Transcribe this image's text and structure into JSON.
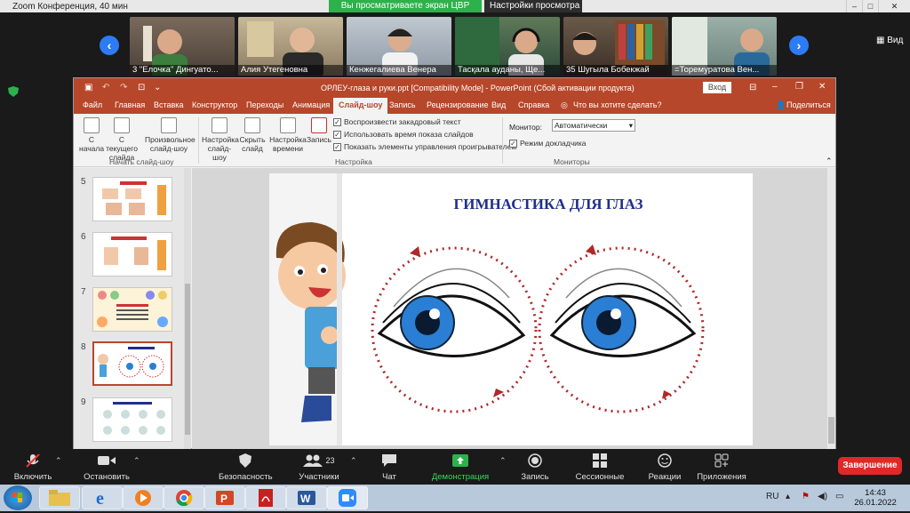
{
  "zoom": {
    "window_title": "Zoom Конференция, 40 мин",
    "share_status": "Вы просматриваете экран ЦВР",
    "view_options": "Настройки просмотра",
    "view_label": "Вид",
    "participants": [
      {
        "name": "3 \"Елочка\" Дингуато..."
      },
      {
        "name": "Алия Утегеновна"
      },
      {
        "name": "Кенжегалиева Венера"
      },
      {
        "name": "Тасқала ауданы, Ще..."
      },
      {
        "name": "35 Шугыла Бобекжай"
      },
      {
        "name": "=Торемуратова Вен..."
      }
    ],
    "toolbar": {
      "unmute": "Включить звук",
      "stop_video": "Остановить видео",
      "security": "Безопасность",
      "participants": "Участники",
      "participants_count": "23",
      "chat": "Чат",
      "share_screen": "Демонстрация экрана",
      "record": "Запись",
      "breakout": "Сессионные залы",
      "reactions": "Реакции",
      "apps": "Приложения",
      "end": "Завершение"
    }
  },
  "ppt": {
    "title": "ОРЛЕУ-глаза и руки.ppt [Compatibility Mode] - PowerPoint (Сбой активации продукта)",
    "signin": "Вход",
    "tabs": [
      "Файл",
      "Главная",
      "Вставка",
      "Конструктор",
      "Переходы",
      "Анимация",
      "Слайд-шоу",
      "Запись",
      "Рецензирование",
      "Вид",
      "Справка"
    ],
    "tell_me": "Что вы хотите сделать?",
    "share": "Поделиться",
    "ribbon": {
      "btn_from_start": "С начала",
      "btn_from_current": "С текущего слайда",
      "btn_custom": "Произвольное слайд-шоу",
      "group_start": "Начать слайд-шоу",
      "btn_setup": "Настройка слайд-шоу",
      "btn_hide": "Скрыть слайд",
      "btn_timings": "Настройка времени",
      "btn_record": "Запись",
      "chk_narration": "Воспроизвести закадровый текст",
      "chk_timings": "Использовать время показа слайдов",
      "chk_media": "Показать элементы управления проигрывателем",
      "group_setup": "Настройка",
      "monitor_label": "Монитор:",
      "monitor_value": "Автоматически",
      "chk_presenter": "Режим докладчика",
      "group_monitors": "Мониторы"
    },
    "slides": [
      {
        "num": "5"
      },
      {
        "num": "6"
      },
      {
        "num": "7"
      },
      {
        "num": "8"
      },
      {
        "num": "9"
      }
    ],
    "current_slide_title": "ГИМНАСТИКА  ДЛЯ  ГЛАЗ"
  },
  "taskbar": {
    "lang": "RU",
    "time": "14:43",
    "date": "26.01.2022"
  },
  "colors": {
    "ppt_accent": "#b7472a",
    "zoom_blue": "#2d7cf6",
    "share_green": "#2db14a",
    "end_red": "#e02828",
    "slide_title": "#1f2f8a",
    "eye_iris": "#2a7fd4"
  }
}
